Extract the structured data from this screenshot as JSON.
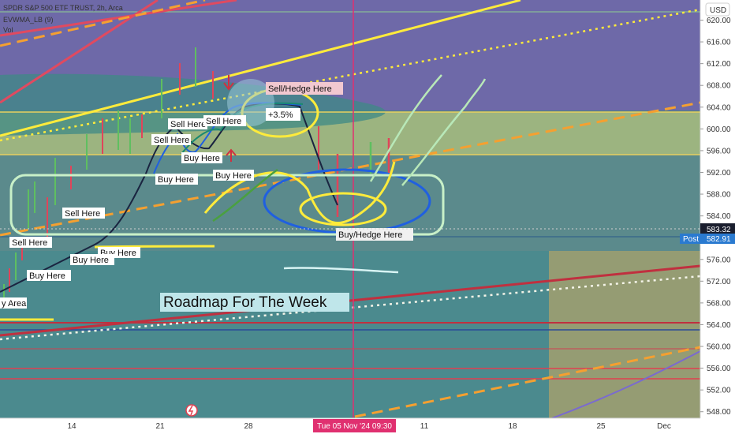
{
  "legend": {
    "symbol_line": "SPDR S&P 500 ETF TRUST, 2h, Arca",
    "indicator_line": "EVWMA_LB (9)",
    "volume_line": "Vol"
  },
  "price_axis": {
    "currency_button": "USD",
    "last_price_badge": "583.32",
    "post_label": "Post",
    "post_price_badge": "582.91"
  },
  "time_axis": {
    "highlight_label": "Tue 05 Nov '24   09:30"
  },
  "annotations": {
    "sell_hedge_top": "Sell/Hedge Here",
    "percent_move": "+3.5%",
    "buy_hedge_bottom": "Buy/Hedge Here",
    "roadmap": "Roadmap For The Week",
    "sell_here_1": "Sell Here",
    "sell_here_2": "Sell Here",
    "sell_here_3": "Sell Here",
    "sell_here_4": "Sell Here",
    "sell_here_5": "Sell Here",
    "buy_here_1": "Buy Here",
    "buy_here_2": "Buy Here",
    "buy_here_3": "Buy Here",
    "buy_here_4": "Buy Here",
    "buy_here_5": "Buy Here",
    "buy_here_6": "Buy Here",
    "area_label": "y Area"
  },
  "colors": {
    "bg_purple": "#6f6aa8",
    "bg_teal": "#4c8a8a",
    "zone_green": "#9fb87a",
    "projection_box": "#9a9a6a",
    "trend_yellow": "#ffeb3b",
    "trend_red": "#e04050",
    "dash_orange": "#f5a030",
    "candle_green": "#5fbf60",
    "candle_red": "#e0455a"
  },
  "chart_data": {
    "type": "candlestick",
    "title": "SPDR S&P 500 ETF TRUST, 2h, Arca",
    "ylabel": "USD",
    "ylim": [
      546.8,
      623.7
    ],
    "y_ticks": [
      548,
      552,
      556,
      560,
      564,
      568,
      572,
      576,
      580,
      584,
      588,
      592,
      596,
      600,
      604,
      608,
      612,
      616,
      620
    ],
    "x_tick_labels": [
      "14",
      "21",
      "28",
      "Nov",
      "11",
      "18",
      "25",
      "Dec"
    ],
    "last_price": 583.32,
    "post_market_price": 582.91,
    "highlighted_time": "Tue 05 Nov '24 09:30",
    "grid": false
  }
}
